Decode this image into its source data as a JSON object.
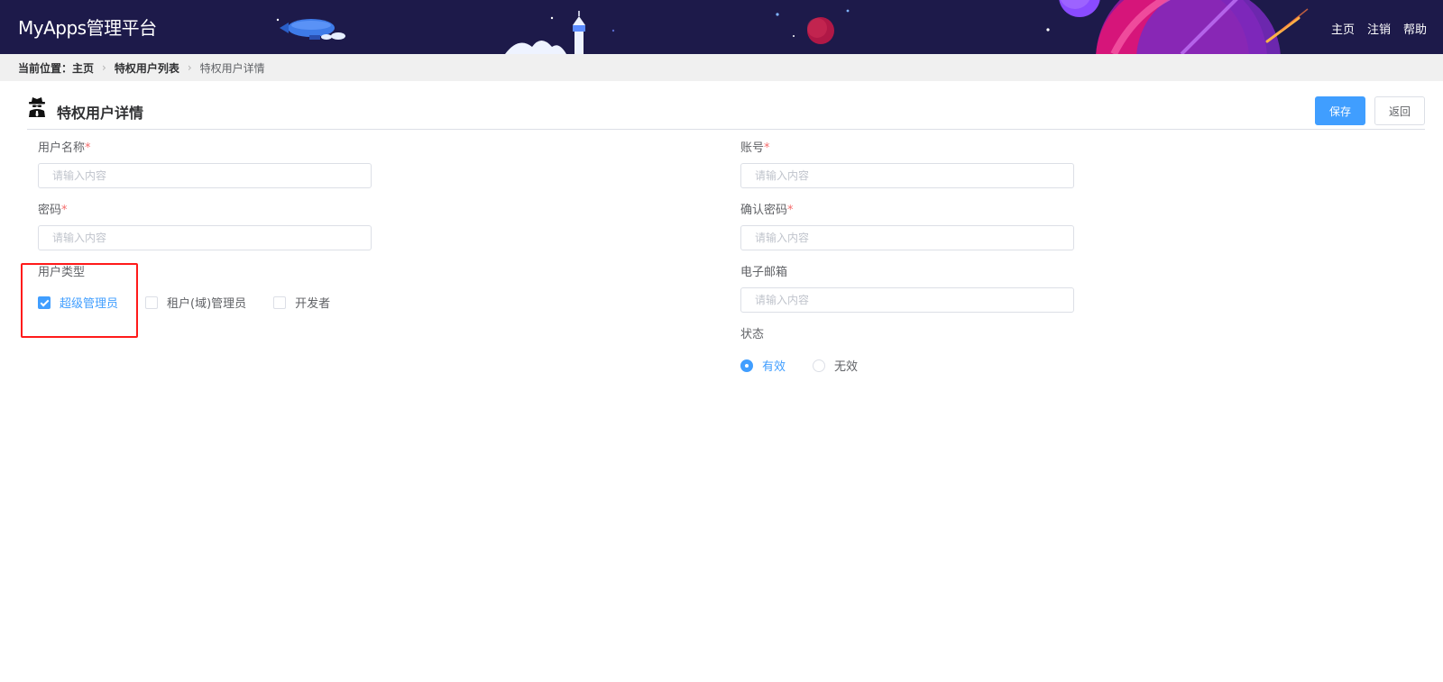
{
  "header": {
    "app_title": "MyApps管理平台",
    "nav": [
      "主页",
      "注销",
      "帮助"
    ]
  },
  "breadcrumb": {
    "prefix": "当前位置：",
    "items": [
      "主页",
      "特权用户列表",
      "特权用户详情"
    ]
  },
  "page": {
    "title": "特权用户详情",
    "save_label": "保存",
    "back_label": "返回"
  },
  "form": {
    "username": {
      "label": "用户名称",
      "required": "*",
      "value": "",
      "placeholder": "请输入内容"
    },
    "account": {
      "label": "账号",
      "required": "*",
      "value": "",
      "placeholder": "请输入内容"
    },
    "password": {
      "label": "密码",
      "required": "*",
      "value": "",
      "placeholder": "请输入内容"
    },
    "confirm_password": {
      "label": "确认密码",
      "required": "*",
      "value": "",
      "placeholder": "请输入内容"
    },
    "email": {
      "label": "电子邮箱",
      "value": "",
      "placeholder": "请输入内容"
    },
    "user_type": {
      "label": "用户类型",
      "options": [
        {
          "label": "超级管理员",
          "checked": true
        },
        {
          "label": "租户(域)管理员",
          "checked": false
        },
        {
          "label": "开发者",
          "checked": false
        }
      ]
    },
    "status": {
      "label": "状态",
      "options": [
        {
          "label": "有效",
          "selected": true
        },
        {
          "label": "无效",
          "selected": false
        }
      ]
    }
  },
  "colors": {
    "header_bg": "#1d1a4a",
    "primary": "#409eff",
    "required": "#f56c6c",
    "highlight": "#ff1a1a"
  }
}
